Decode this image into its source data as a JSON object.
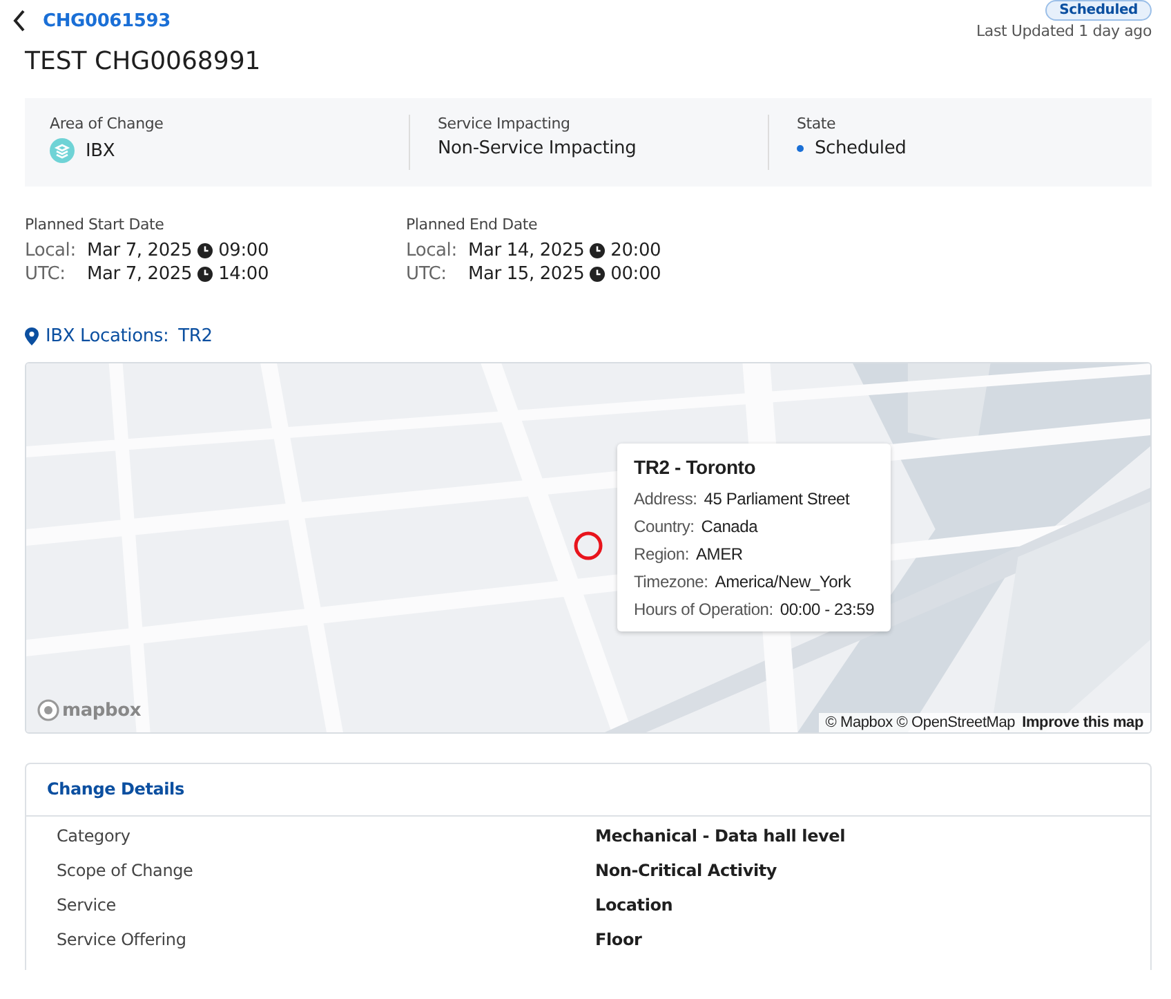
{
  "header": {
    "back_link": "CHG0061593",
    "status_badge": "Scheduled",
    "last_updated": "Last Updated 1 day ago",
    "title": "TEST CHG0068991"
  },
  "summary": [
    {
      "kind": "icon",
      "label": "Area of Change",
      "value": "IBX"
    },
    {
      "kind": "plain",
      "label": "Service Impacting",
      "value": "Non-Service Impacting"
    },
    {
      "kind": "dot",
      "label": "State",
      "value": "Scheduled",
      "color": "#1a6fd6"
    }
  ],
  "dates": [
    {
      "label": "Planned Start Date",
      "rows": [
        {
          "zone": "Local:",
          "date": "Mar 7, 2025",
          "time": "09:00"
        },
        {
          "zone": "UTC:",
          "date": "Mar 7, 2025",
          "time": "14:00"
        }
      ]
    },
    {
      "label": "Planned End Date",
      "rows": [
        {
          "zone": "Local:",
          "date": "Mar 14, 2025",
          "time": "20:00"
        },
        {
          "zone": "UTC:",
          "date": "Mar 15, 2025",
          "time": "00:00"
        }
      ]
    }
  ],
  "locations": {
    "label": "IBX Locations:",
    "value": "TR2"
  },
  "map": {
    "kind": "picture",
    "logo": "mapbox",
    "attribution": "© Mapbox © OpenStreetMap",
    "improve_link": "Improve this map",
    "popup": {
      "title": "TR2 - Toronto",
      "fields": [
        {
          "label": "Address:",
          "value": "45 Parliament Street"
        },
        {
          "label": "Country:",
          "value": "Canada"
        },
        {
          "label": "Region:",
          "value": "AMER"
        },
        {
          "label": "Timezone:",
          "value": "America/New_York"
        },
        {
          "label": "Hours of Operation:",
          "value": "00:00 - 23:59"
        }
      ]
    }
  },
  "change_details": {
    "title": "Change Details",
    "rows": [
      {
        "label": "Category",
        "value": "Mechanical - Data hall level"
      },
      {
        "label": "Scope of Change",
        "value": "Non-Critical Activity"
      },
      {
        "label": "Service",
        "value": "Location"
      },
      {
        "label": "Service Offering",
        "value": "Floor"
      }
    ]
  }
}
